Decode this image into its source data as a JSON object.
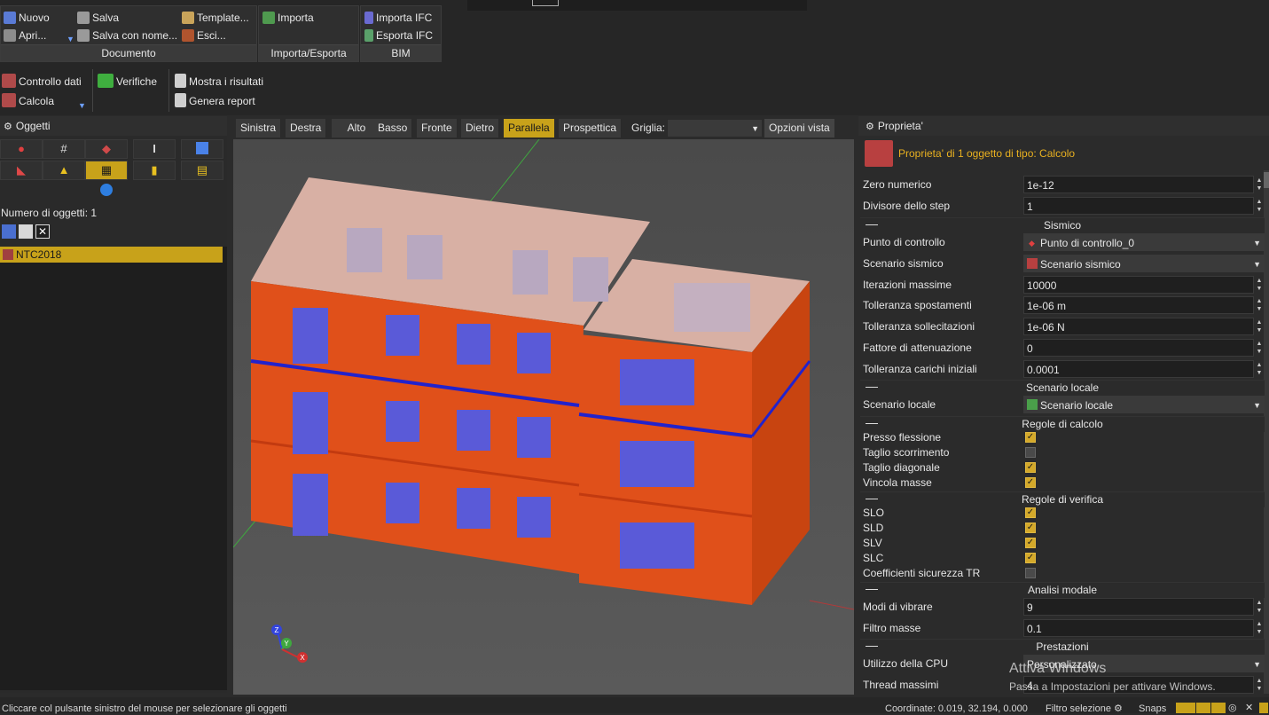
{
  "ribbon": {
    "documento": {
      "label": "Documento",
      "nuovo": "Nuovo",
      "apri": "Apri...",
      "salva": "Salva",
      "salva_con_nome": "Salva con nome...",
      "template": "Template...",
      "esci": "Esci..."
    },
    "importa_esporta": {
      "label": "Importa/Esporta",
      "importa": "Importa"
    },
    "bim": {
      "label": "BIM",
      "importa_ifc": "Importa IFC",
      "esporta_ifc": "Esporta IFC"
    },
    "secondary": {
      "controllo_dati": "Controllo dati",
      "calcola": "Calcola",
      "verifiche": "Verifiche",
      "mostra_risultati": "Mostra i risultati",
      "genera_report": "Genera report"
    }
  },
  "oggetti": {
    "title": "Oggetti",
    "count_text": "Numero di oggetti: 1",
    "items": [
      {
        "label": "NTC2018"
      }
    ]
  },
  "view_toolbar": {
    "buttons": [
      "Sinistra",
      "Destra",
      "Alto",
      "Basso",
      "Fronte",
      "Dietro",
      "Parallela",
      "Prospettica"
    ],
    "active": "Parallela",
    "griglia_label": "Griglia:",
    "griglia_value": "",
    "opzioni_vista": "Opzioni vista"
  },
  "axes": {
    "z": "Z",
    "y": "Y",
    "x": "X"
  },
  "proprieta": {
    "title": "Proprieta'",
    "header": "Proprieta' di 1 oggetto di tipo: Calcolo",
    "zero_numerico": {
      "label": "Zero numerico",
      "value": "1e-12"
    },
    "divisore_step": {
      "label": "Divisore dello step",
      "value": "1"
    },
    "sismico": {
      "title": "Sismico",
      "punto_controllo": {
        "label": "Punto di controllo",
        "value": "Punto di controllo_0"
      },
      "scenario_sismico": {
        "label": "Scenario sismico",
        "value": "Scenario sismico"
      },
      "iterazioni": {
        "label": "Iterazioni massime",
        "value": "10000"
      },
      "tol_spost": {
        "label": "Tolleranza spostamenti",
        "value": "1e-06 m"
      },
      "tol_soll": {
        "label": "Tolleranza sollecitazioni",
        "value": "1e-06 N"
      },
      "fattore": {
        "label": "Fattore di attenuazione",
        "value": "0"
      },
      "tol_carichi": {
        "label": "Tolleranza carichi iniziali",
        "value": "0.0001"
      }
    },
    "scenario_locale": {
      "title": "Scenario locale",
      "label": "Scenario locale",
      "value": "Scenario locale"
    },
    "regole_calcolo": {
      "title": "Regole di calcolo",
      "items": [
        {
          "label": "Presso flessione",
          "checked": true
        },
        {
          "label": "Taglio scorrimento",
          "checked": false
        },
        {
          "label": "Taglio diagonale",
          "checked": true
        },
        {
          "label": "Vincola masse",
          "checked": true
        }
      ]
    },
    "regole_verifica": {
      "title": "Regole di verifica",
      "items": [
        {
          "label": "SLO",
          "checked": true
        },
        {
          "label": "SLD",
          "checked": true
        },
        {
          "label": "SLV",
          "checked": true
        },
        {
          "label": "SLC",
          "checked": true
        },
        {
          "label": "Coefficienti sicurezza TR",
          "checked": false
        }
      ]
    },
    "analisi_modale": {
      "title": "Analisi modale",
      "modi": {
        "label": "Modi di vibrare",
        "value": "9"
      },
      "filtro": {
        "label": "Filtro masse",
        "value": "0.1"
      }
    },
    "prestazioni": {
      "title": "Prestazioni",
      "cpu": {
        "label": "Utilizzo della CPU",
        "value": "Personalizzato"
      },
      "thread": {
        "label": "Thread massimi",
        "value": "4"
      }
    }
  },
  "watermark": {
    "line1": "Attiva Windows",
    "line2": "Passa a Impostazioni per attivare Windows."
  },
  "status": {
    "message": "Cliccare col pulsante sinistro del mouse per selezionare gli oggetti",
    "coordinate": "Coordinate: 0.019, 32.194, 0.000",
    "filtro": "Filtro selezione",
    "snaps": "Snaps"
  }
}
